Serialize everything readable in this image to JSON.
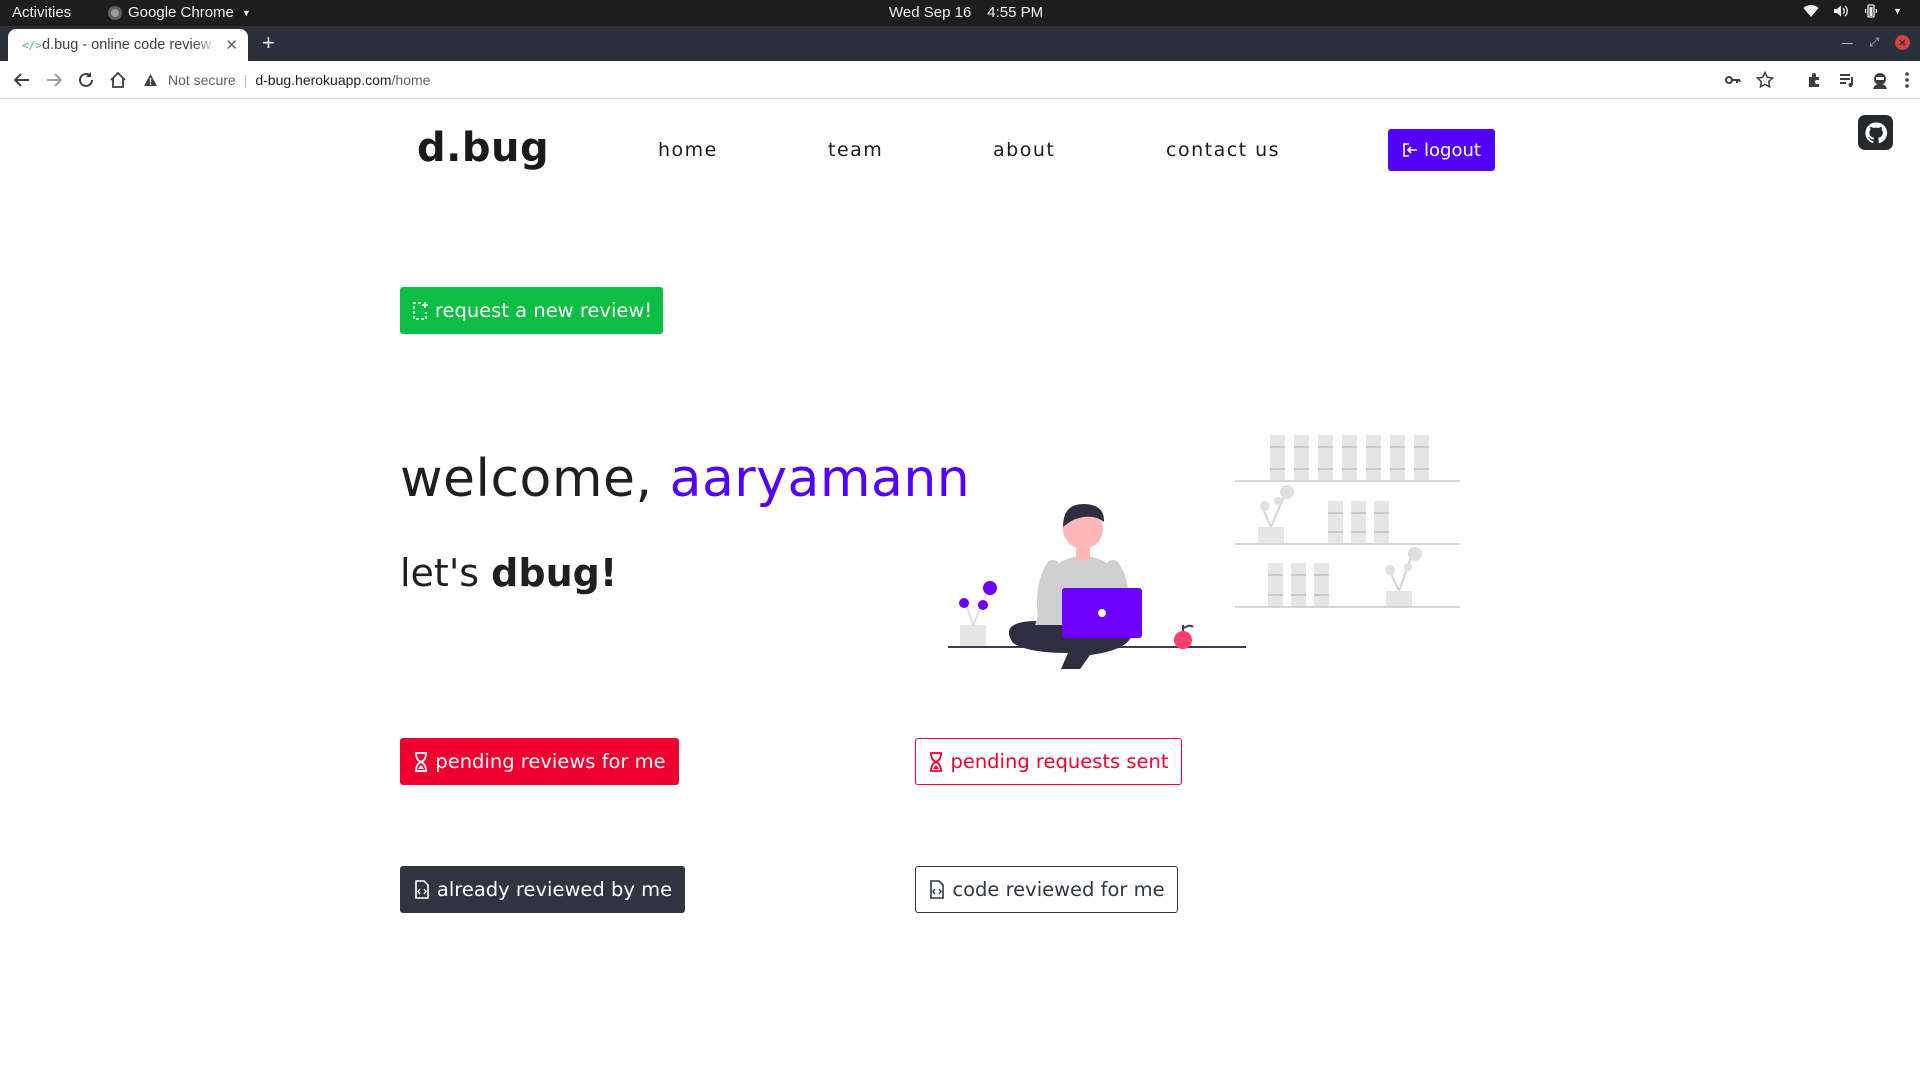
{
  "system_bar": {
    "activities": "Activities",
    "app_name": "Google Chrome",
    "date": "Wed Sep 16",
    "time": "4:55 PM"
  },
  "browser": {
    "tab_title": "d.bug - online code review",
    "url_warning": "Not secure",
    "url_host": "d-bug.herokuapp.com",
    "url_path": "/home"
  },
  "nav": {
    "logo": "d.bug",
    "links": [
      "home",
      "team",
      "about",
      "contact us"
    ],
    "logout_label": "logout"
  },
  "main": {
    "request_button": "request a new review!",
    "welcome_prefix": "welcome, ",
    "username": "aaryamann",
    "tagline_prefix": "let's ",
    "tagline_bold": "dbug!"
  },
  "actions": {
    "pending_for_me": "pending reviews for me",
    "pending_sent": "pending requests sent",
    "reviewed_by_me": "already reviewed by me",
    "reviewed_for_me": "code reviewed for me"
  },
  "colors": {
    "brand_purple": "#5200ff",
    "success_green": "#0dbd44",
    "danger_red": "#f0002e",
    "dark": "#2f3640"
  }
}
